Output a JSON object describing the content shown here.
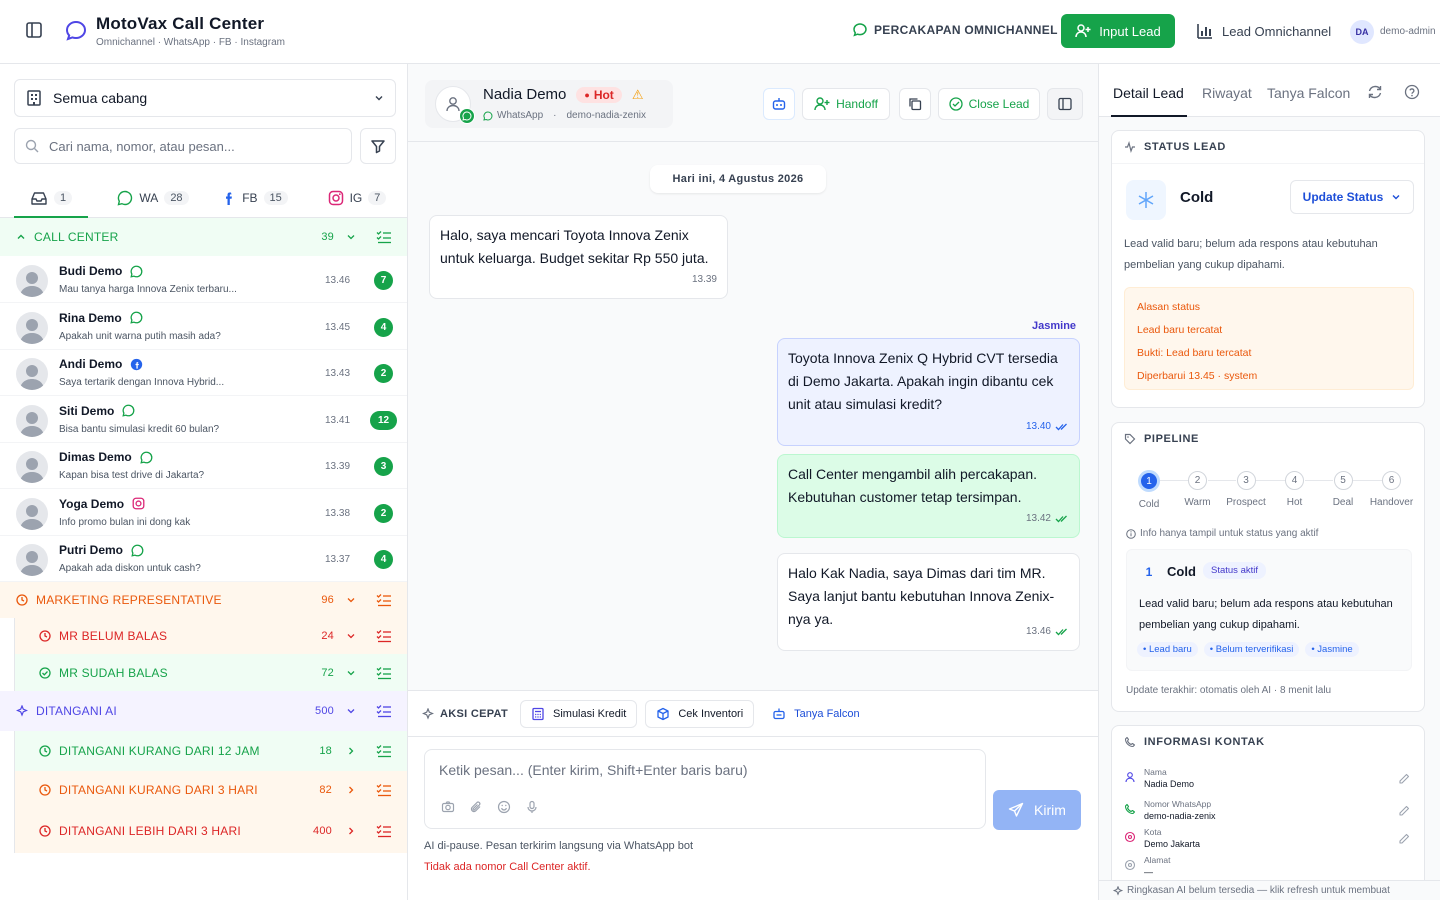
{
  "header": {
    "title": "MotoVax Call Center",
    "subtitle": "Omnichannel · WhatsApp · FB · Instagram",
    "omni_label": "PERCAKAPAN OMNICHANNEL",
    "input_lead_label": "Input Lead",
    "lead_omni_label": "Lead Omnichannel",
    "avatar_initials": "DA",
    "username": "demo-admin"
  },
  "sidebar": {
    "branch": "Semua cabang",
    "search_placeholder": "Cari nama, nomor, atau pesan...",
    "tabs": [
      {
        "label": "",
        "count": "1"
      },
      {
        "label": "WA",
        "count": "28"
      },
      {
        "label": "FB",
        "count": "15"
      },
      {
        "label": "IG",
        "count": "7"
      }
    ],
    "call_center": {
      "label": "CALL CENTER",
      "count": "39"
    },
    "conversations": [
      {
        "name": "Budi Demo",
        "channel": "whatsapp",
        "preview": "Mau tanya harga Innova Zenix terbaru...",
        "time": "13.46",
        "unread": "7"
      },
      {
        "name": "Rina Demo",
        "channel": "whatsapp",
        "preview": "Apakah unit warna putih masih ada?",
        "time": "13.45",
        "unread": "4"
      },
      {
        "name": "Andi Demo",
        "channel": "facebook",
        "preview": "Saya tertarik dengan Innova Hybrid...",
        "time": "13.43",
        "unread": "2"
      },
      {
        "name": "Siti Demo",
        "channel": "whatsapp",
        "preview": "Bisa bantu simulasi kredit 60 bulan?",
        "time": "13.41",
        "unread": "12"
      },
      {
        "name": "Dimas Demo",
        "channel": "whatsapp",
        "preview": "Kapan bisa test drive di Jakarta?",
        "time": "13.39",
        "unread": "3"
      },
      {
        "name": "Yoga Demo",
        "channel": "instagram",
        "preview": "Info promo bulan ini dong kak",
        "time": "13.38",
        "unread": "2"
      },
      {
        "name": "Putri Demo",
        "channel": "whatsapp",
        "preview": "Apakah ada diskon untuk cash?",
        "time": "13.37",
        "unread": "4"
      }
    ],
    "marketing": {
      "label": "MARKETING REPRESENTATIVE",
      "count": "96"
    },
    "mr_belum": {
      "label": "MR BELUM BALAS",
      "count": "24"
    },
    "mr_sudah": {
      "label": "MR SUDAH BALAS",
      "count": "72"
    },
    "ditangani_ai": {
      "label": "DITANGANI AI",
      "count": "500"
    },
    "ai_12jam": {
      "label": "DITANGANI KURANG DARI 12 JAM",
      "count": "18"
    },
    "ai_3hari": {
      "label": "DITANGANI KURANG DARI 3 HARI",
      "count": "82"
    },
    "ai_lebih": {
      "label": "DITANGANI LEBIH DARI 3 HARI",
      "count": "400"
    }
  },
  "chat": {
    "contact_name": "Nadia Demo",
    "hot_label": "Hot",
    "channel": "WhatsApp",
    "contact_id": "demo-nadia-zenix",
    "handoff_label": "Handoff",
    "close_lead_label": "Close Lead",
    "date_label": "Hari ini, 4 Agustus 2026",
    "sender": "Jasmine",
    "messages": [
      {
        "text": "Halo, saya mencari Toyota Innova Zenix untuk keluarga. Budget sekitar Rp 550 juta.",
        "time": "13.39"
      },
      {
        "text": "Toyota Innova Zenix Q Hybrid CVT tersedia di Demo Jakarta. Apakah ingin dibantu cek unit atau simulasi kredit?",
        "time": "13.40"
      },
      {
        "text": "Call Center mengambil alih percakapan. Kebutuhan customer tetap tersimpan.",
        "time": "13.42"
      },
      {
        "text": "Halo Kak Nadia, saya Dimas dari tim MR. Saya lanjut bantu kebutuhan Innova Zenix-nya ya.",
        "time": "13.46"
      }
    ],
    "quick_label": "AKSI CEPAT",
    "quick_actions": [
      "Simulasi Kredit",
      "Cek Inventori",
      "Tanya Falcon"
    ],
    "composer_placeholder": "Ketik pesan... (Enter kirim, Shift+Enter baris baru)",
    "send_label": "Kirim",
    "note_ai": "AI di-pause. Pesan terkirim langsung via WhatsApp bot",
    "note_error": "Tidak ada nomor Call Center aktif."
  },
  "detail": {
    "tabs": [
      "Detail Lead",
      "Riwayat",
      "Tanya Falcon"
    ],
    "status_title": "STATUS LEAD",
    "status_value": "Cold",
    "update_status_label": "Update Status",
    "status_desc": "Lead valid baru; belum ada respons atau kebutuhan pembelian yang cukup dipahami.",
    "alasan": [
      "Alasan status",
      "Lead baru tercatat",
      "Bukti: Lead baru tercatat",
      "Diperbarui 13.45 · system"
    ],
    "pipeline_title": "PIPELINE",
    "pipeline_steps": [
      {
        "n": "1",
        "label": "Cold"
      },
      {
        "n": "2",
        "label": "Warm"
      },
      {
        "n": "3",
        "label": "Prospect"
      },
      {
        "n": "4",
        "label": "Hot"
      },
      {
        "n": "5",
        "label": "Deal"
      },
      {
        "n": "6",
        "label": "Handover"
      }
    ],
    "pipeline_info": "Info hanya tampil untuk status yang aktif",
    "active_num": "1",
    "active_label": "Cold",
    "active_badge": "Status aktif",
    "active_desc": "Lead valid baru; belum ada respons atau kebutuhan pembelian yang cukup dipahami.",
    "active_tags": [
      "• Lead baru",
      "• Belum terverifikasi",
      "• Jasmine"
    ],
    "last_update": "Update terakhir: otomatis oleh AI · 8 menit lalu",
    "contact_title": "INFORMASI KONTAK",
    "contact_fields": [
      {
        "label": "Nama",
        "value": "Nadia Demo"
      },
      {
        "label": "Nomor WhatsApp",
        "value": "demo-nadia-zenix"
      },
      {
        "label": "Kota",
        "value": "Demo Jakarta"
      },
      {
        "label": "Alamat",
        "value": "—"
      }
    ],
    "footer": "Ringkasan AI belum tersedia — klik refresh untuk membuat"
  },
  "colors": {
    "primary": "#16a34a",
    "hot": "#dc2626",
    "accent": "#2563eb",
    "marketing": "#ea580c",
    "ai": "#4f46e5"
  }
}
